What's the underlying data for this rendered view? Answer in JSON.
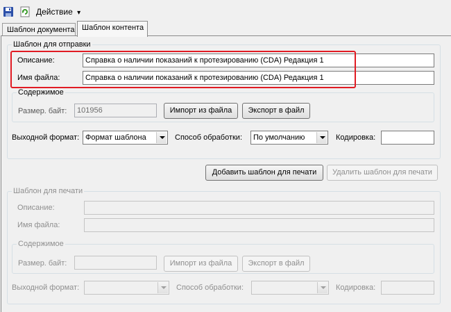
{
  "toolbar": {
    "save_icon": "save-icon",
    "refresh_icon": "refresh-icon",
    "action_label": "Действие",
    "action_arrow": "▾"
  },
  "tabs": [
    {
      "label": "Шаблон документа",
      "active": false
    },
    {
      "label": "Шаблон контента",
      "active": true
    }
  ],
  "send_template": {
    "legend": "Шаблон для отправки",
    "description_label": "Описание:",
    "description_value": "Справка о наличии показаний к протезированию (CDA) Редакция 1",
    "filename_label": "Имя файла:",
    "filename_value": "Справка о наличии показаний к протезированию (CDA) Редакция 1",
    "content": {
      "legend": "Содержимое",
      "size_label": "Размер. байт:",
      "size_value": "101956",
      "import_button": "Импорт из файла",
      "export_button": "Экспорт в файл"
    },
    "output_format_label": "Выходной формат:",
    "output_format_value": "Формат шаблона",
    "processing_label": "Способ обработки:",
    "processing_value": "По умолчанию",
    "encoding_label": "Кодировка:",
    "encoding_value": ""
  },
  "actions": {
    "add_print_button": "Добавить шаблон для печати",
    "delete_print_button": "Удалить шаблон для печати"
  },
  "print_template": {
    "legend": "Шаблон для печати",
    "description_label": "Описание:",
    "description_value": "",
    "filename_label": "Имя файла:",
    "filename_value": "",
    "content": {
      "legend": "Содержимое",
      "size_label": "Размер. байт:",
      "size_value": "",
      "import_button": "Импорт из файла",
      "export_button": "Экспорт в файл"
    },
    "output_format_label": "Выходной формат:",
    "output_format_value": "",
    "processing_label": "Способ обработки:",
    "processing_value": "",
    "encoding_label": "Кодировка:",
    "encoding_value": ""
  },
  "colors": {
    "highlight": "#e11b23",
    "save_icon": "#2b4fa8",
    "refresh_icon": "#3a9a2a"
  }
}
